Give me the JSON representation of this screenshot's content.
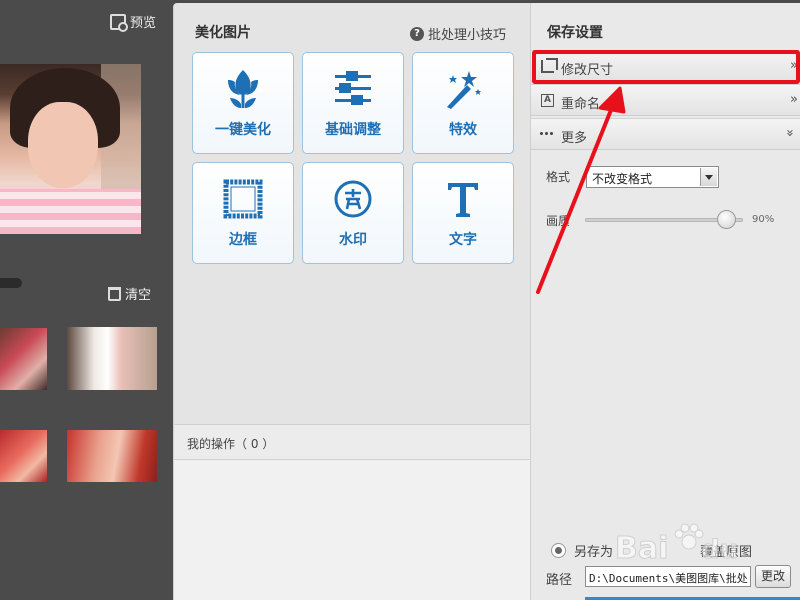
{
  "left": {
    "preview_label": "预览",
    "clear_label": "清空"
  },
  "middle": {
    "title": "美化图片",
    "tips_label": "批处理小技巧",
    "tools": [
      {
        "label": "一键美化",
        "icon": "tulip-icon"
      },
      {
        "label": "基础调整",
        "icon": "adjust-sliders-icon"
      },
      {
        "label": "特效",
        "icon": "magic-wand-icon"
      },
      {
        "label": "边框",
        "icon": "frame-icon"
      },
      {
        "label": "水印",
        "icon": "watermark-stamp-icon"
      },
      {
        "label": "文字",
        "icon": "text-t-icon"
      }
    ],
    "ops_label": "我的操作（ 0 ）"
  },
  "right": {
    "title": "保存设置",
    "sections": {
      "resize": "修改尺寸",
      "rename": "重命名",
      "more": "更多"
    },
    "format_label": "格式",
    "format_value": "不改变格式",
    "quality_label": "画质",
    "quality_value": "90%",
    "quality_fraction": 0.9,
    "save_as_label": "另存为",
    "overwrite_label": "覆盖原图",
    "path_label": "路径",
    "path_value": "D:\\Documents\\美图图库\\批处",
    "change_label": "更改"
  },
  "colors": {
    "accent": "#1f6fb5",
    "highlight": "#e8111b",
    "tool_border": "#9ec3df"
  },
  "watermark": "Baidu"
}
